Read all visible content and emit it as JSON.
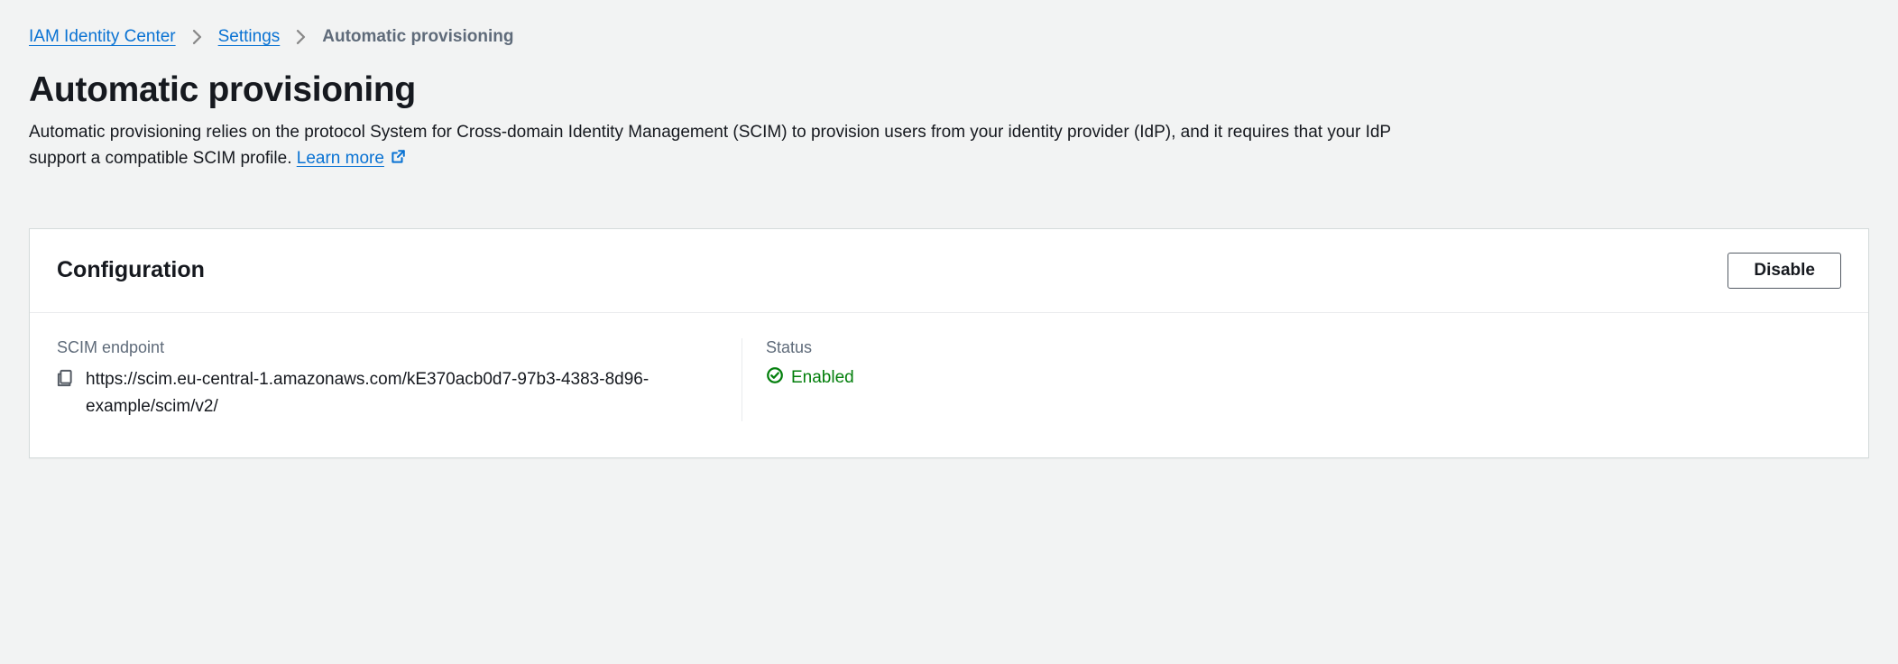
{
  "breadcrumb": {
    "items": [
      {
        "label": "IAM Identity Center"
      },
      {
        "label": "Settings"
      }
    ],
    "current": "Automatic provisioning"
  },
  "page": {
    "title": "Automatic provisioning",
    "description": "Automatic provisioning relies on the protocol System for Cross-domain Identity Management (SCIM) to provision users from your identity provider (IdP), and it requires that your IdP support a compatible SCIM profile. ",
    "learn_more": "Learn more"
  },
  "config_panel": {
    "title": "Configuration",
    "disable_label": "Disable",
    "endpoint_label": "SCIM endpoint",
    "endpoint_value": "https://scim.eu-central-1.amazonaws.com/kE370acb0d7-97b3-4383-8d96-example/scim/v2/",
    "status_label": "Status",
    "status_value": "Enabled"
  },
  "colors": {
    "link": "#0972d3",
    "success": "#037f0c"
  }
}
